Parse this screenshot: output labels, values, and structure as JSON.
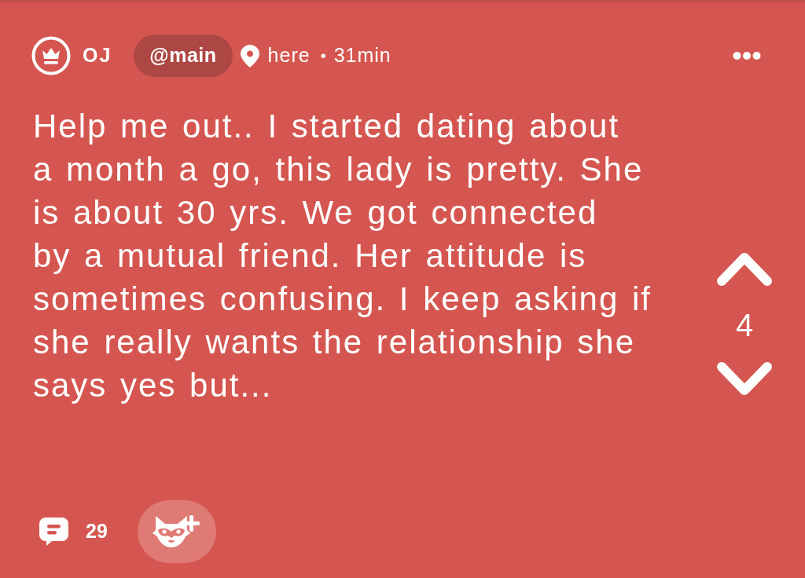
{
  "post": {
    "author": {
      "name": "OJ"
    },
    "channel": "@main",
    "location": "here",
    "separator": "•",
    "time": "31min",
    "body": "Help me out.. I started dating about\na month a go, this lady is pretty. She\nis about 30 yrs. We got connected\nby a mutual friend. Her attitude is\nsometimes confusing. I keep asking if\nshe really wants the relationship she\nsays yes but...",
    "votes": {
      "count": "4"
    },
    "comments": {
      "count": "29"
    }
  }
}
